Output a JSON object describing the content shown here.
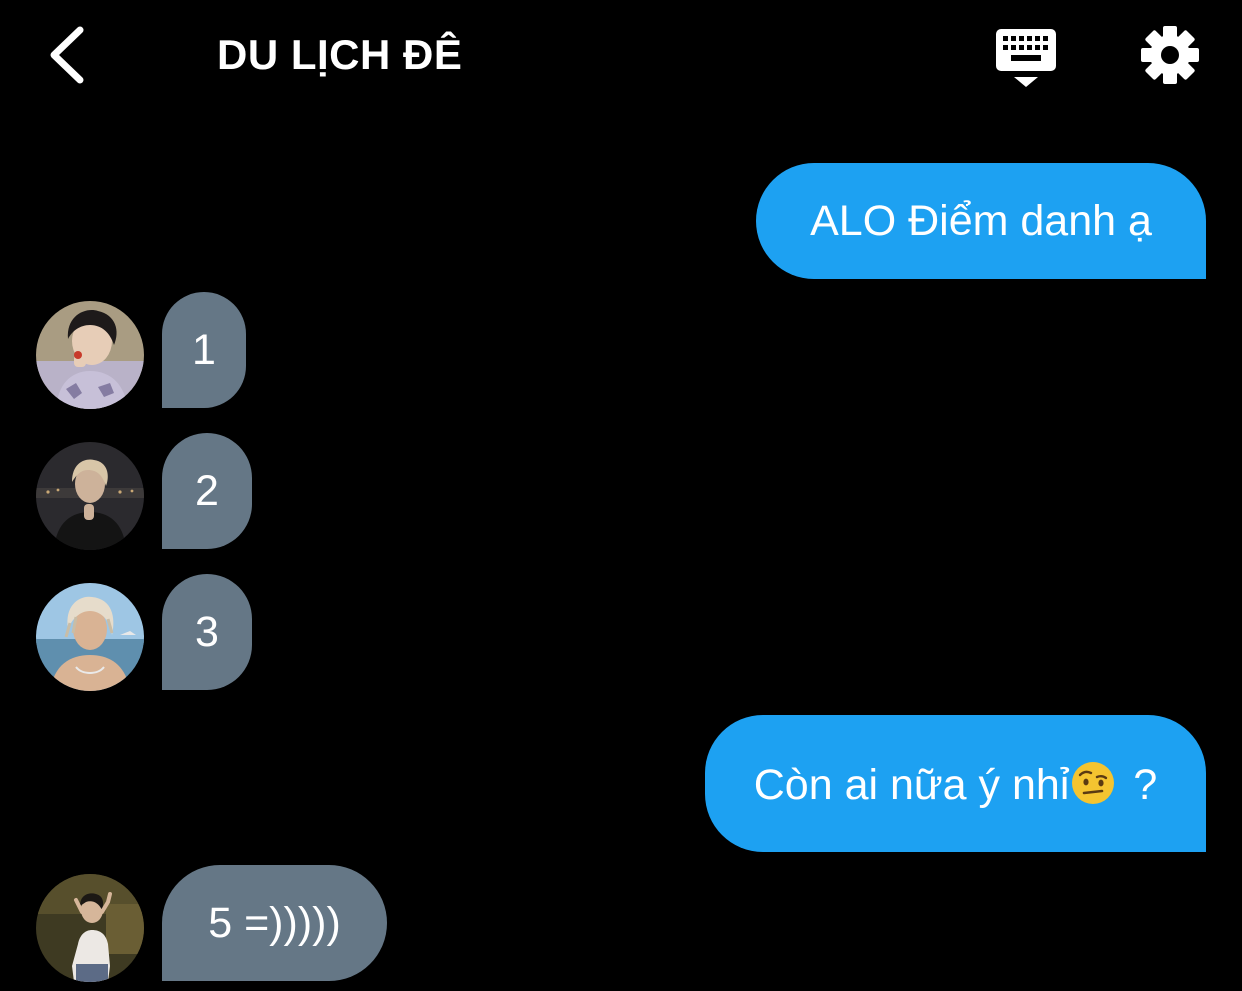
{
  "header": {
    "title": "DU LỊCH ĐÊ",
    "back_icon": "chevron-left-icon",
    "keyboard_icon": "keyboard-icon",
    "settings_icon": "gear-icon"
  },
  "messages": [
    {
      "direction": "outgoing",
      "text": "ALO Điểm danh ạ"
    },
    {
      "direction": "incoming",
      "text": "1",
      "avatar": "user-1-avatar"
    },
    {
      "direction": "incoming",
      "text": "2",
      "avatar": "user-2-avatar"
    },
    {
      "direction": "incoming",
      "text": "3",
      "avatar": "user-3-avatar"
    },
    {
      "direction": "outgoing",
      "text_before_emoji": "Còn ai nữa ý nhỉ",
      "emoji": "raised-eyebrow-emoji",
      "text_after_emoji": " ?"
    },
    {
      "direction": "incoming",
      "text": "5 =)))))",
      "avatar": "user-4-avatar"
    }
  ],
  "colors": {
    "background": "#000000",
    "outgoing_bubble": "#1da1f2",
    "incoming_bubble": "#657786",
    "text": "#ffffff"
  }
}
